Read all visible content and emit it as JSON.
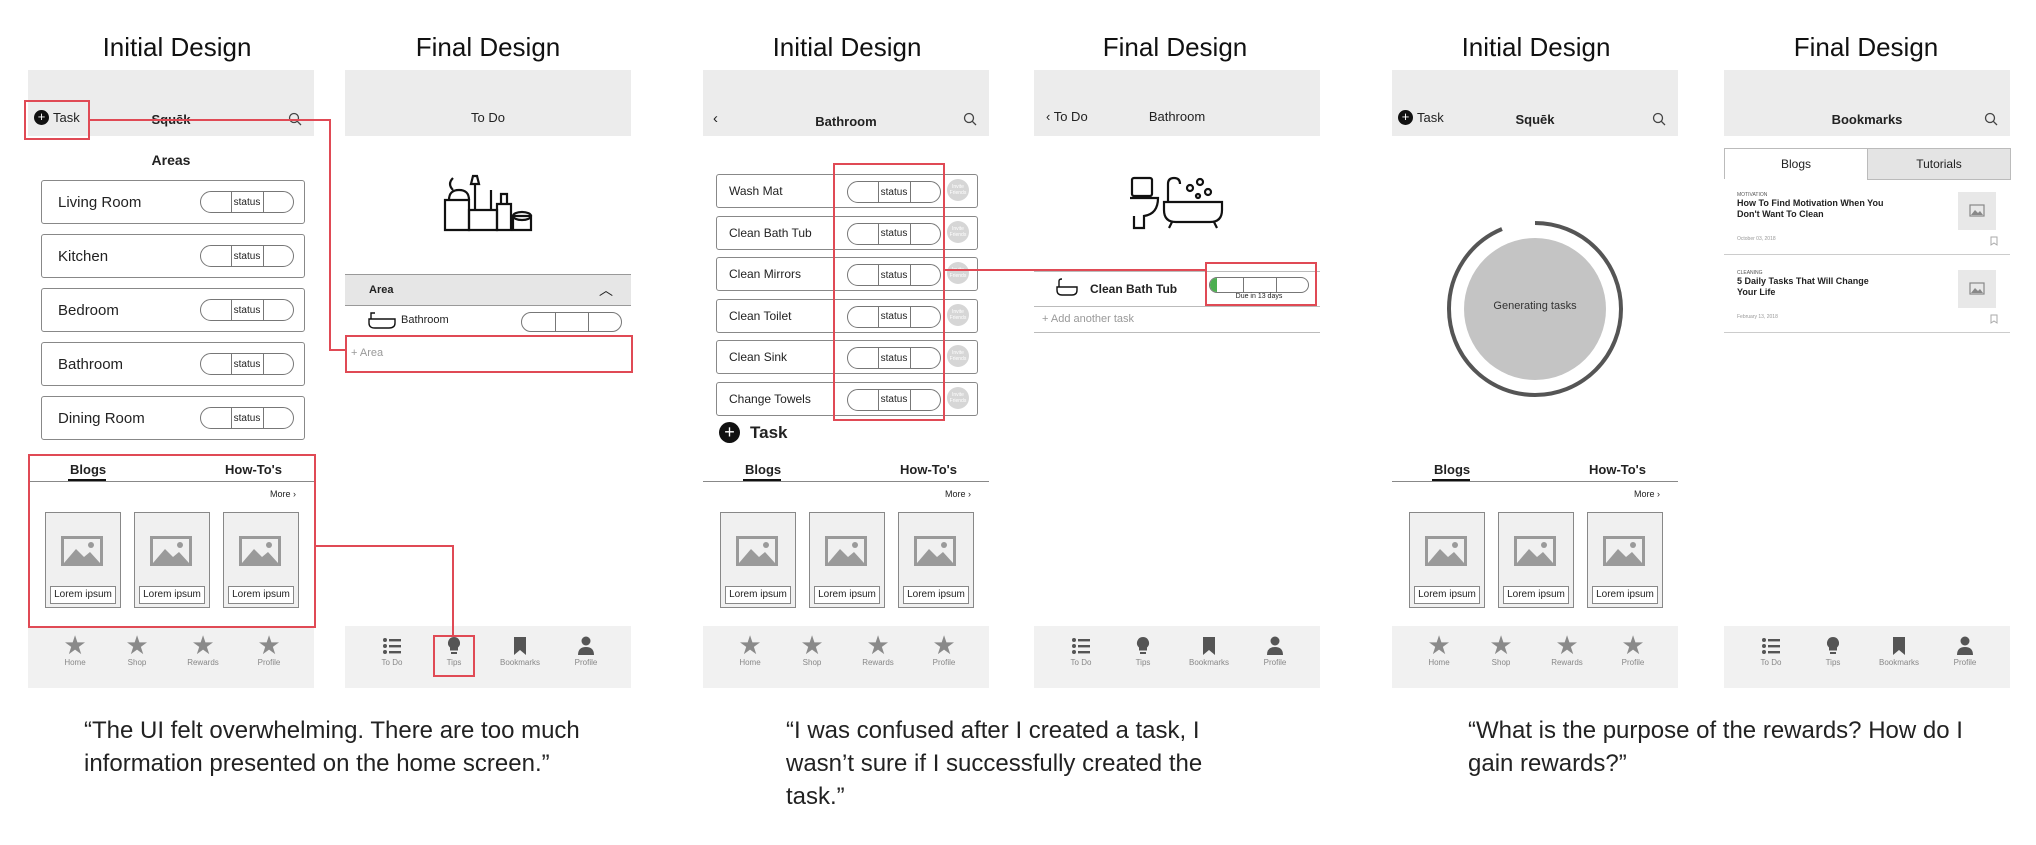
{
  "titles": {
    "t1": "Initial Design",
    "t2": "Final Design",
    "t3": "Initial Design",
    "t4": "Final Design",
    "t5": "Initial Design",
    "t6": "Final Design"
  },
  "p1": {
    "task_label": "Task",
    "app_name": "Squēk",
    "areas_title": "Areas",
    "rooms": [
      "Living Room",
      "Kitchen",
      "Bedroom",
      "Bathroom",
      "Dining Room"
    ],
    "status": "status",
    "tab_blogs": "Blogs",
    "tab_howtos": "How-To's",
    "more": "More",
    "cards": [
      "Lorem ipsum",
      "Lorem ipsum",
      "Lorem ipsum"
    ],
    "nav": [
      "Home",
      "Shop",
      "Rewards",
      "Profile"
    ]
  },
  "p2": {
    "title": "To Do",
    "area_header": "Area",
    "area_item": "Bathroom",
    "add_area": "Area",
    "nav": [
      "To Do",
      "Tips",
      "Bookmarks",
      "Profile"
    ]
  },
  "p3": {
    "title": "Bathroom",
    "tasks": [
      "Wash Mat",
      "Clean Bath Tub",
      "Clean Mirrors",
      "Clean Toilet",
      "Clean Sink",
      "Change Towels"
    ],
    "status": "status",
    "circle_text": "Invite Friends",
    "task_label": "Task",
    "tab_blogs": "Blogs",
    "tab_howtos": "How-To's",
    "more": "More",
    "cards": [
      "Lorem ipsum",
      "Lorem ipsum",
      "Lorem ipsum"
    ],
    "nav": [
      "Home",
      "Shop",
      "Rewards",
      "Profile"
    ]
  },
  "p4": {
    "back": "To Do",
    "title": "Bathroom",
    "task": "Clean Bath Tub",
    "due": "Due in 13 days",
    "add_task": "Add another task",
    "nav": [
      "To Do",
      "Tips",
      "Bookmarks",
      "Profile"
    ]
  },
  "p5": {
    "task_label": "Task",
    "app_name": "Squēk",
    "generating": "Generating tasks",
    "tab_blogs": "Blogs",
    "tab_howtos": "How-To's",
    "more": "More",
    "cards": [
      "Lorem ipsum",
      "Lorem ipsum",
      "Lorem ipsum"
    ],
    "nav": [
      "Home",
      "Shop",
      "Rewards",
      "Profile"
    ]
  },
  "p6": {
    "title": "Bookmarks",
    "tab_blogs": "Blogs",
    "tab_tutorials": "Tutorials",
    "posts": [
      {
        "cat": "MOTIVATION",
        "title": "How To Find Motivation When You Don't Want To Clean",
        "date": "October 03, 2018"
      },
      {
        "cat": "CLEANING",
        "title": "5 Daily Tasks That Will Change Your Life",
        "date": "February 13, 2018"
      }
    ],
    "nav": [
      "To Do",
      "Tips",
      "Bookmarks",
      "Profile"
    ]
  },
  "quotes": {
    "q1": "“The UI felt overwhelming. There are too much information presented on the home screen.”",
    "q2": "“I was confused after I created a task, I wasn’t sure if I successfully created the task.”",
    "q3": "“What is the purpose of the rewards? How do I gain rewards?”"
  },
  "colors": {
    "highlight": "#e04a55",
    "progress": "#4caf50",
    "header": "#ececec"
  }
}
